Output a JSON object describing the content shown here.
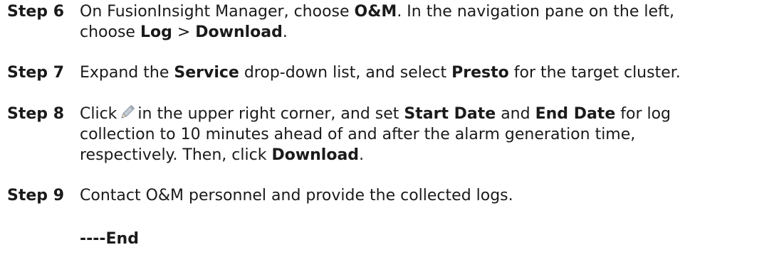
{
  "steps": [
    {
      "label": "Step 6",
      "lines": [
        [
          "On FusionInsight Manager, choose ",
          "O&M",
          ". In the navigation pane on the left,"
        ],
        [
          "choose ",
          "Log",
          " > ",
          "Download",
          "."
        ]
      ]
    },
    {
      "label": "Step 7",
      "parts": [
        "Expand the ",
        "Service",
        " drop-down list, and select ",
        "Presto",
        " for the target cluster."
      ]
    },
    {
      "label": "Step 8",
      "line1": [
        "Click",
        "in the upper right corner, and set ",
        "Start Date",
        " and ",
        "End Date",
        " for log"
      ],
      "line2": "collection to 10 minutes ahead of and after the alarm generation time,",
      "line3": [
        "respectively. Then, click ",
        "Download",
        "."
      ],
      "icon": "pencil-edit-icon"
    },
    {
      "label": "Step 9",
      "text": "Contact O&M personnel and provide the collected logs."
    }
  ],
  "end_marker": "----End",
  "colors": {
    "text": "#1a1a1a",
    "pencil_body": "#9fa8b3",
    "pencil_tip": "#5b7fb5"
  }
}
